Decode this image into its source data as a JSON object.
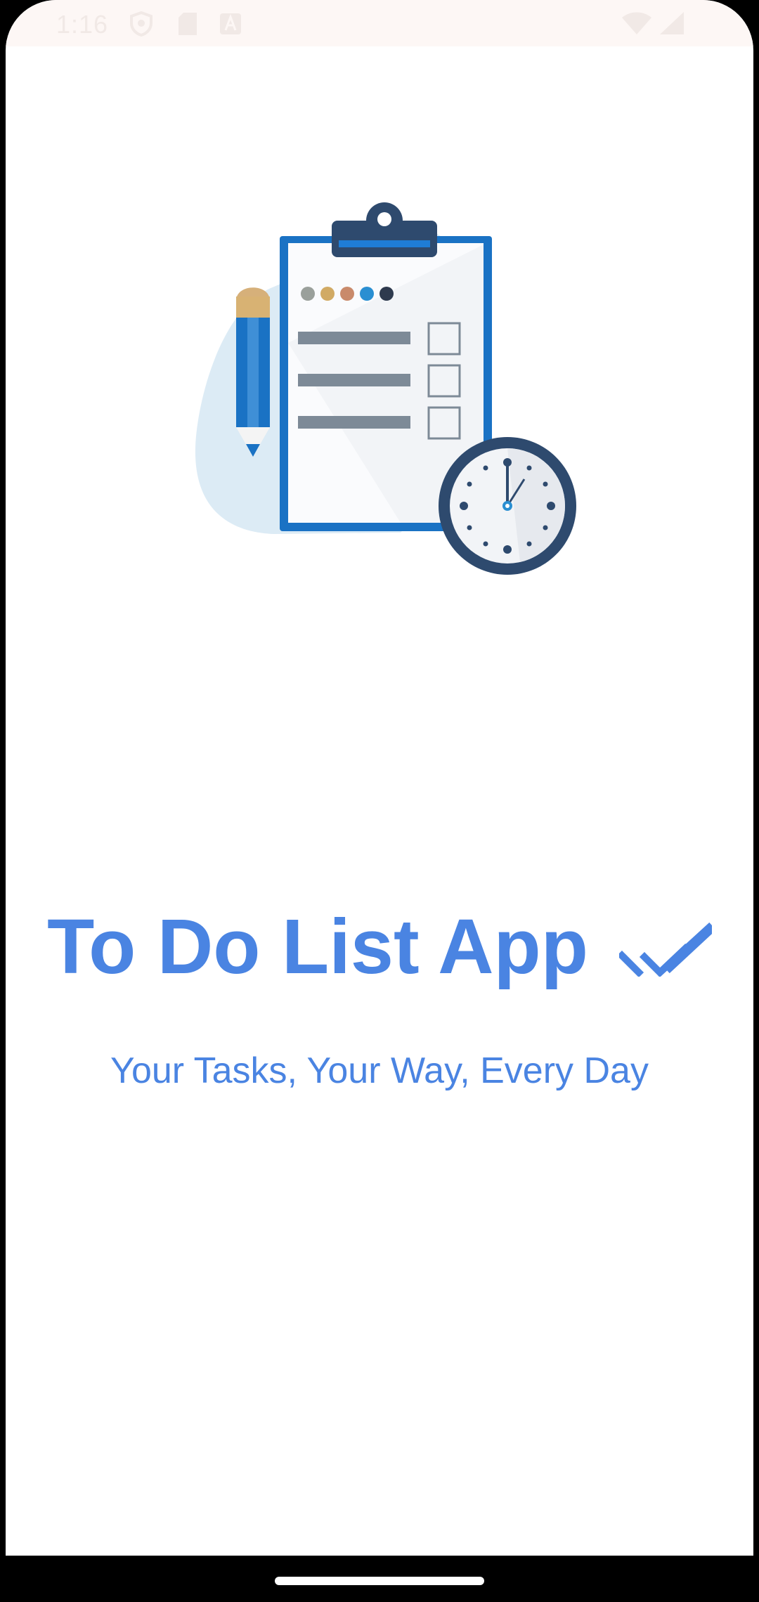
{
  "status_bar": {
    "time": "1:16",
    "icons": [
      "shield-icon",
      "sim-card-icon",
      "font-a-icon",
      "wifi-icon",
      "signal-icon"
    ]
  },
  "illustration": {
    "name": "clipboard-checklist-clock-illustration",
    "colors": {
      "blob": "#dcebf5",
      "clipboard": "#1a72c4",
      "clip": "#2e4a6e",
      "pencil": "#1a72c4",
      "clock": "#2e4a6e"
    }
  },
  "splash": {
    "title": "To Do List App",
    "title_icon": "double-check-icon",
    "tagline": "Your Tasks, Your Way, Every Day"
  },
  "colors": {
    "accent": "#4a84e2",
    "background": "#ffffff"
  },
  "navigation_bar": {
    "handle": "home-gesture-handle"
  }
}
